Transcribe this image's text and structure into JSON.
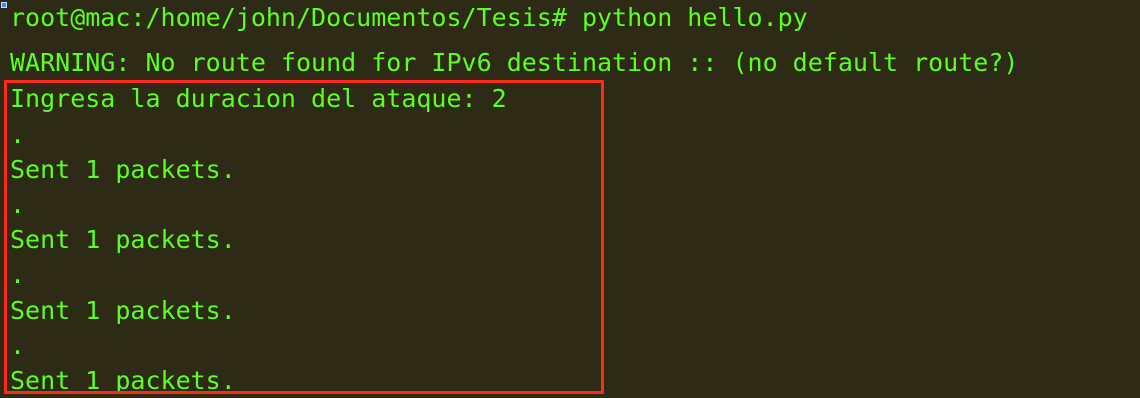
{
  "terminal": {
    "lines": [
      "root@mac:/home/john/Documentos/Tesis# python hello.py",
      "WARNING: No route found for IPv6 destination :: (no default route?)",
      "Ingresa la duracion del ataque: 2",
      ".",
      "Sent 1 packets.",
      ".",
      "Sent 1 packets.",
      ".",
      "Sent 1 packets.",
      ".",
      "Sent 1 packets."
    ]
  },
  "colors": {
    "background": "#2d2a16",
    "text": "#5cff1f",
    "highlight_border": "#ff2a1a"
  }
}
